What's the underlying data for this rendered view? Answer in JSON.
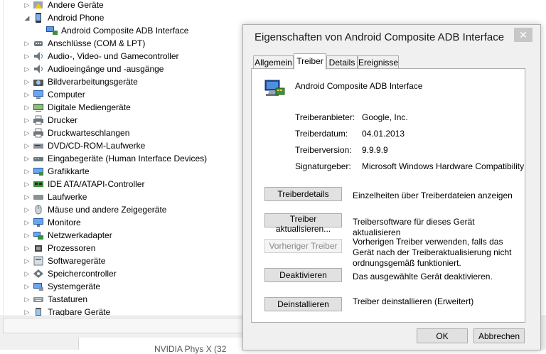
{
  "device_tree": [
    {
      "label": "Andere Geräte",
      "expanded": false,
      "icon": "warning-device-icon"
    },
    {
      "label": "Android Phone",
      "expanded": true,
      "icon": "android-phone-icon"
    },
    {
      "label": "Android Composite ADB Interface",
      "child": true,
      "icon": "adb-interface-icon"
    },
    {
      "label": "Anschlüsse (COM & LPT)",
      "expanded": false,
      "icon": "port-icon"
    },
    {
      "label": "Audio-, Video- und Gamecontroller",
      "expanded": false,
      "icon": "speaker-icon"
    },
    {
      "label": "Audioeingänge und -ausgänge",
      "expanded": false,
      "icon": "speaker-icon"
    },
    {
      "label": "Bildverarbeitungsgeräte",
      "expanded": false,
      "icon": "camera-icon"
    },
    {
      "label": "Computer",
      "expanded": false,
      "icon": "computer-icon"
    },
    {
      "label": "Digitale Mediengeräte",
      "expanded": false,
      "icon": "media-device-icon"
    },
    {
      "label": "Drucker",
      "expanded": false,
      "icon": "printer-icon"
    },
    {
      "label": "Druckwarteschlangen",
      "expanded": false,
      "icon": "printer-icon"
    },
    {
      "label": "DVD/CD-ROM-Laufwerke",
      "expanded": false,
      "icon": "disc-drive-icon"
    },
    {
      "label": "Eingabegeräte (Human Interface Devices)",
      "expanded": false,
      "icon": "hid-icon"
    },
    {
      "label": "Grafikkarte",
      "expanded": false,
      "icon": "display-adapter-icon"
    },
    {
      "label": "IDE ATA/ATAPI-Controller",
      "expanded": false,
      "icon": "controller-icon"
    },
    {
      "label": "Laufwerke",
      "expanded": false,
      "icon": "disk-drive-icon"
    },
    {
      "label": "Mäuse und andere Zeigegeräte",
      "expanded": false,
      "icon": "mouse-icon"
    },
    {
      "label": "Monitore",
      "expanded": false,
      "icon": "monitor-icon"
    },
    {
      "label": "Netzwerkadapter",
      "expanded": false,
      "icon": "network-adapter-icon"
    },
    {
      "label": "Prozessoren",
      "expanded": false,
      "icon": "processor-icon"
    },
    {
      "label": "Softwaregeräte",
      "expanded": false,
      "icon": "software-device-icon"
    },
    {
      "label": "Speichercontroller",
      "expanded": false,
      "icon": "storage-controller-icon"
    },
    {
      "label": "Systemgeräte",
      "expanded": false,
      "icon": "system-device-icon"
    },
    {
      "label": "Tastaturen",
      "expanded": false,
      "icon": "keyboard-icon"
    },
    {
      "label": "Tragbare Geräte",
      "expanded": false,
      "icon": "portable-device-icon"
    }
  ],
  "background_cut_text": "NVIDIA Phys X (32",
  "dialog": {
    "title": "Eigenschaften von Android Composite ADB Interface",
    "close_glyph": "✕",
    "tabs": [
      "Allgemein",
      "Treiber",
      "Details",
      "Ereignisse"
    ],
    "active_tab": "Treiber",
    "device_name": "Android Composite ADB Interface",
    "properties": [
      {
        "label": "Treiberanbieter:",
        "value": "Google, Inc."
      },
      {
        "label": "Treiberdatum:",
        "value": "04.01.2013"
      },
      {
        "label": "Treiberversion:",
        "value": "9.9.9.9"
      },
      {
        "label": "Signaturgeber:",
        "value": "Microsoft Windows Hardware Compatibility"
      }
    ],
    "actions": [
      {
        "button": "Treiberdetails",
        "description": "Einzelheiten über Treiberdateien anzeigen",
        "enabled": true
      },
      {
        "button": "Treiber aktualisieren...",
        "description": "Treibersoftware für dieses Gerät aktualisieren",
        "enabled": true
      },
      {
        "button": "Vorheriger Treiber",
        "description": "Vorherigen Treiber verwenden, falls das Gerät nach der Treiberaktualisierung nicht ordnungsgemäß funktioniert.",
        "enabled": false
      },
      {
        "button": "Deaktivieren",
        "description": "Das ausgewählte Gerät deaktivieren.",
        "enabled": true
      },
      {
        "button": "Deinstallieren",
        "description": "Treiber deinstallieren (Erweitert)",
        "enabled": true
      }
    ],
    "ok_label": "OK",
    "cancel_label": "Abbrechen"
  },
  "colors": {
    "dialog_background": "#f0f0f0",
    "button_face": "#e1e1e1",
    "close_button": "#c7c7c7",
    "disabled_text": "#8a8a8a"
  }
}
